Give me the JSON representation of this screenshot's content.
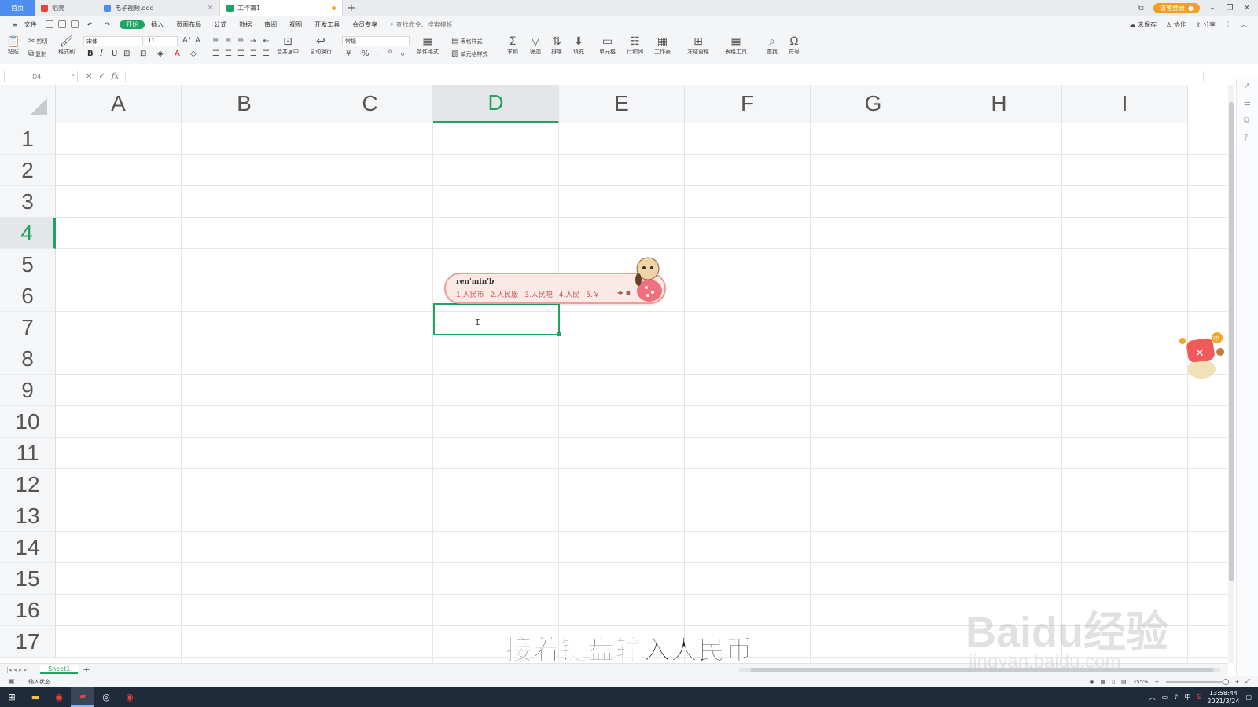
{
  "titlebar": {
    "home_tab": "首页",
    "tabs": [
      {
        "label": "稻壳",
        "icon_color": "#e8443a"
      },
      {
        "label": "电子视频.doc",
        "icon_color": "#4d8ef0"
      },
      {
        "label": "工作簿1",
        "icon_color": "#1fa463"
      }
    ],
    "new_tab": "+",
    "login_label": "访客登录"
  },
  "menu": {
    "file": "文件",
    "items": [
      "开始",
      "插入",
      "页面布局",
      "公式",
      "数据",
      "审阅",
      "视图",
      "开发工具",
      "会员专享"
    ],
    "active": "开始",
    "search": "查找命令、搜索模板",
    "right": [
      "未保存",
      "协作",
      "分享"
    ]
  },
  "toolbar": {
    "paste": "粘贴",
    "cut": "剪切",
    "copy": "复制",
    "format_painter": "格式刷",
    "font_name": "宋体",
    "font_size": "11",
    "number_format": "常规",
    "merge": "合并居中",
    "wrap": "自动换行",
    "cond_format": "条件格式",
    "table_style": "表格样式",
    "cell_style": "单元格样式",
    "sum": "求和",
    "filter": "筛选",
    "sort": "排序",
    "fill": "填充",
    "cell": "单元格",
    "rowcol": "行和列",
    "worksheet": "工作表",
    "freeze": "冻结窗格",
    "table_tools": "表格工具",
    "find": "查找",
    "symbol": "符号"
  },
  "formula_bar": {
    "name_box": "D4",
    "fx": "fx",
    "value": ""
  },
  "grid": {
    "columns": [
      "A",
      "B",
      "C",
      "D",
      "E",
      "F",
      "G",
      "H",
      "I"
    ],
    "rows": [
      "1",
      "2",
      "3",
      "4",
      "5",
      "6",
      "7",
      "8",
      "9",
      "10",
      "11",
      "12",
      "13",
      "14",
      "15",
      "16",
      "17"
    ],
    "selected_column": "D",
    "selected_row": "4",
    "accent": "#1fa463"
  },
  "ime": {
    "pinyin": "ren'min'b",
    "candidates": [
      "1.人民币",
      "2.人民版",
      "3.人民吧",
      "4.人民",
      "5.￥"
    ]
  },
  "sheets": {
    "tabs": [
      "Sheet1"
    ],
    "add": "+"
  },
  "statusbar": {
    "mode": "输入状态",
    "zoom": "355%"
  },
  "taskbar": {
    "time": "13:58:44",
    "date": "2021/3/24",
    "lang": "中"
  },
  "overlay": {
    "subtitle": "接着键盘输入人民币",
    "watermark": "Baidu经验",
    "watermark_url": "jingyan.baidu.com"
  }
}
